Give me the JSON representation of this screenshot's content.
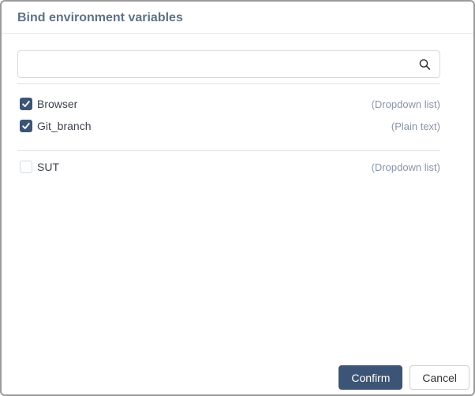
{
  "dialog": {
    "title": "Bind environment variables",
    "search": {
      "placeholder": "",
      "value": "",
      "icon": "search-icon"
    },
    "list": {
      "groups": [
        {
          "items": [
            {
              "label": "Browser",
              "type": "(Dropdown list)",
              "checked": true
            },
            {
              "label": "Git_branch",
              "type": "(Plain text)",
              "checked": true
            }
          ]
        },
        {
          "items": [
            {
              "label": "SUT",
              "type": "(Dropdown list)",
              "checked": false
            }
          ]
        }
      ]
    },
    "footer": {
      "confirm_label": "Confirm",
      "cancel_label": "Cancel"
    }
  },
  "colors": {
    "accent": "#3c5476",
    "modal_border": "#9b9b9b",
    "title_color": "#5f7285",
    "label_color": "#3d434b",
    "type_color": "#8895a8",
    "divider": "#dde3e9",
    "header_divider": "#ececec",
    "input_border": "#d9d9d9",
    "cancel_border": "#d0d0d0",
    "cancel_text": "#333333"
  }
}
